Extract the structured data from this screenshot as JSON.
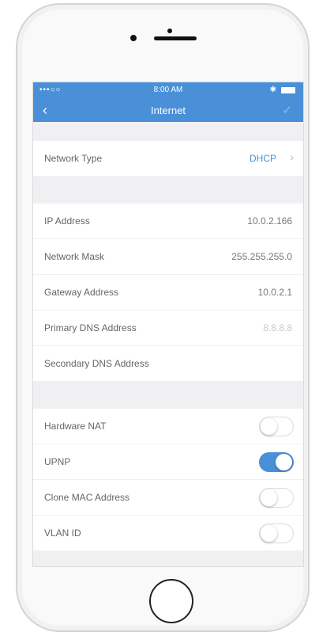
{
  "status_bar": {
    "signal": "•••○○ ",
    "time": "8:00 AM",
    "bluetooth": "✱"
  },
  "nav": {
    "back_icon": "‹",
    "title": "Internet",
    "confirm_icon": "✓"
  },
  "network_type": {
    "label": "Network Type",
    "value": "DHCP",
    "chevron": "›"
  },
  "fields": [
    {
      "label": "IP Address",
      "value": "10.0.2.166"
    },
    {
      "label": "Network Mask",
      "value": "255.255.255.0"
    },
    {
      "label": "Gateway Address",
      "value": "10.0.2.1"
    },
    {
      "label": "Primary DNS Address",
      "value": "8.8.8.8"
    },
    {
      "label": "Secondary DNS Address",
      "value": ""
    }
  ],
  "toggles": [
    {
      "label": "Hardware NAT",
      "on": false
    },
    {
      "label": "UPNP",
      "on": true
    },
    {
      "label": "Clone MAC Address",
      "on": false
    },
    {
      "label": "VLAN ID",
      "on": false
    }
  ],
  "colors": {
    "accent": "#4a90d9",
    "background": "#f0f0f2"
  }
}
